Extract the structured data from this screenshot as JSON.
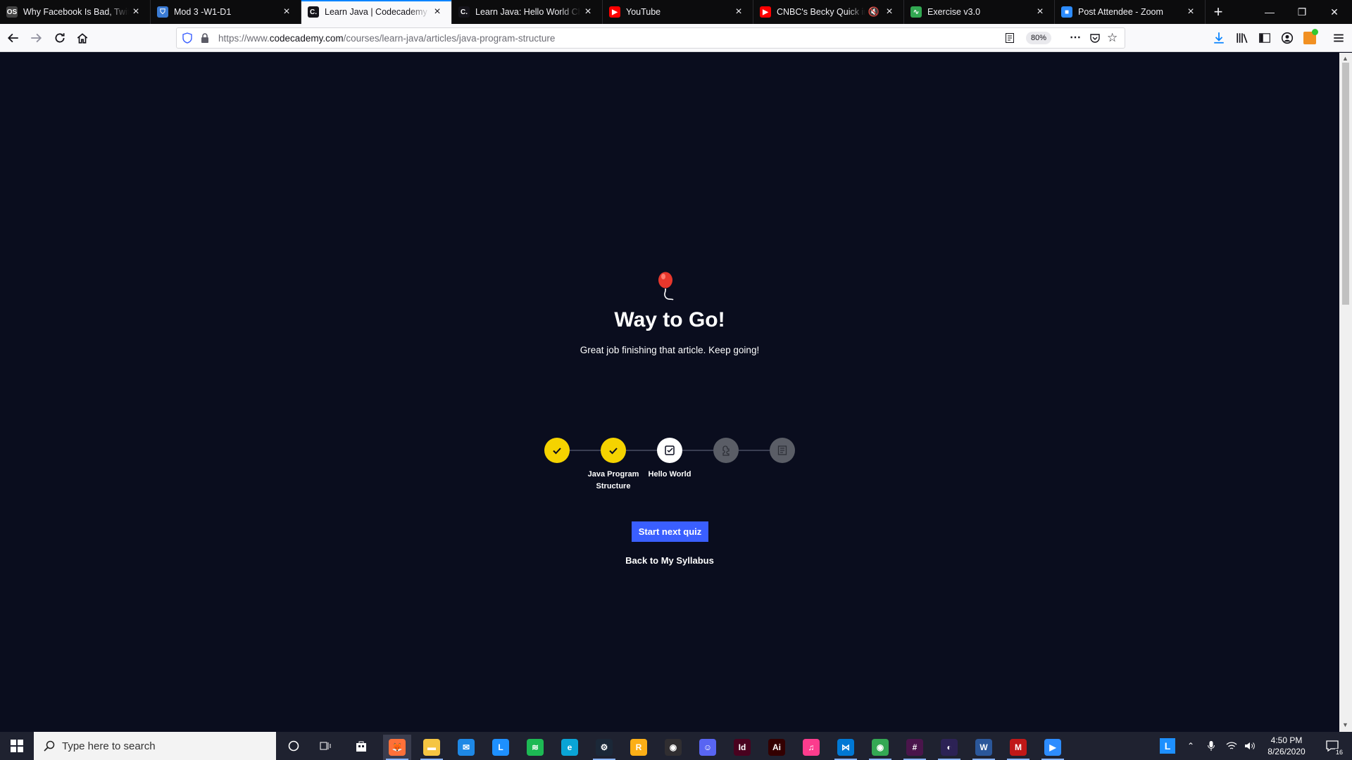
{
  "browser": {
    "tabs": [
      {
        "title": "Why Facebook Is Bad, Twitter",
        "favicon": "news-icon",
        "color": "#444444",
        "glyph": "OS"
      },
      {
        "title": "Mod 3 -W1-D1",
        "favicon": "mortarboard-icon",
        "color": "#3a7bd5",
        "glyph": "⛉"
      },
      {
        "title": "Learn Java | Codecademy",
        "favicon": "codecademy-icon",
        "color": "#15141a",
        "glyph": "C."
      },
      {
        "title": "Learn Java: Hello World Chea",
        "favicon": "codecademy-icon",
        "color": "#15141a",
        "glyph": "C."
      },
      {
        "title": "YouTube",
        "favicon": "youtube-icon",
        "color": "#ff0000",
        "glyph": "▶"
      },
      {
        "title": "CNBC's Becky Quick inter",
        "favicon": "youtube-icon",
        "color": "#ff0000",
        "glyph": "▶"
      },
      {
        "title": "Exercise v3.0",
        "favicon": "chart-icon",
        "color": "#32a852",
        "glyph": "∿"
      },
      {
        "title": "Post Attendee - Zoom",
        "favicon": "zoom-icon",
        "color": "#2d8cff",
        "glyph": "■"
      }
    ],
    "active_tab": 2,
    "url_prefix": "https://www.",
    "url_domain": "codecademy.com",
    "url_path": "/courses/learn-java/articles/java-program-structure",
    "zoom": "80%"
  },
  "page": {
    "heading": "Way to Go!",
    "subtext": "Great job finishing that article. Keep going!",
    "steps": [
      {
        "state": "done",
        "label": ""
      },
      {
        "state": "done",
        "label": "Java Program Structure"
      },
      {
        "state": "current",
        "label": "Hello World"
      },
      {
        "state": "locked",
        "label": ""
      },
      {
        "state": "locked",
        "label": ""
      }
    ],
    "next_button": "Start next quiz",
    "back_link": "Back to My Syllabus"
  },
  "taskbar": {
    "search_placeholder": "Type here to search",
    "time": "4:50 PM",
    "date": "8/26/2020",
    "notification_count": "16",
    "apps": [
      {
        "name": "firefox",
        "glyph": "🦊",
        "color": "#ff7139"
      },
      {
        "name": "file-explorer",
        "glyph": "▬",
        "color": "#f5c542"
      },
      {
        "name": "mail",
        "glyph": "✉",
        "color": "#1e88e5"
      },
      {
        "name": "app-l",
        "glyph": "L",
        "color": "#1e90ff"
      },
      {
        "name": "spotify",
        "glyph": "≋",
        "color": "#1db954"
      },
      {
        "name": "edge",
        "glyph": "e",
        "color": "#0aa4d6"
      },
      {
        "name": "steam",
        "glyph": "⚙",
        "color": "#1b2838"
      },
      {
        "name": "rockstar",
        "glyph": "R",
        "color": "#fcaf17"
      },
      {
        "name": "obs",
        "glyph": "◉",
        "color": "#302e31"
      },
      {
        "name": "discord",
        "glyph": "☺",
        "color": "#5865f2"
      },
      {
        "name": "indesign",
        "glyph": "Id",
        "color": "#49021f"
      },
      {
        "name": "illustrator",
        "glyph": "Ai",
        "color": "#330000"
      },
      {
        "name": "itunes",
        "glyph": "♫",
        "color": "#fc3c8d"
      },
      {
        "name": "vscode",
        "glyph": "⋈",
        "color": "#0078d4"
      },
      {
        "name": "chrome",
        "glyph": "◉",
        "color": "#34a853"
      },
      {
        "name": "slack",
        "glyph": "#",
        "color": "#4a154b"
      },
      {
        "name": "eclipse",
        "glyph": "◐",
        "color": "#2c2255"
      },
      {
        "name": "word",
        "glyph": "W",
        "color": "#2b579a"
      },
      {
        "name": "mcafee",
        "glyph": "M",
        "color": "#c01818"
      },
      {
        "name": "zoom",
        "glyph": "▶",
        "color": "#2d8cff"
      }
    ]
  }
}
